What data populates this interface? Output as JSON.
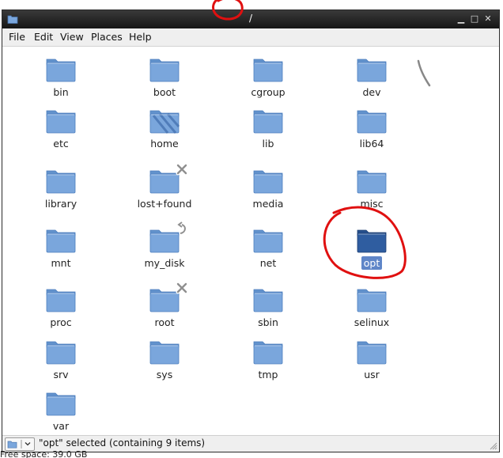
{
  "window": {
    "title": "/",
    "menu": [
      "File",
      "Edit",
      "View",
      "Places",
      "Help"
    ],
    "controls": [
      "minimize",
      "maximize",
      "close"
    ]
  },
  "items": [
    {
      "name": "bin"
    },
    {
      "name": "boot"
    },
    {
      "name": "cgroup"
    },
    {
      "name": "dev"
    },
    {
      "name": "etc"
    },
    {
      "name": "home",
      "special": "home"
    },
    {
      "name": "lib"
    },
    {
      "name": "lib64"
    },
    {
      "name": "library"
    },
    {
      "name": "lost+found",
      "emblem": "x-icon"
    },
    {
      "name": "media"
    },
    {
      "name": "misc"
    },
    {
      "name": "mnt"
    },
    {
      "name": "my_disk",
      "emblem": "symlink-arrow-icon"
    },
    {
      "name": "net"
    },
    {
      "name": "opt",
      "selected": true
    },
    {
      "name": "proc"
    },
    {
      "name": "root",
      "emblem": "x-icon"
    },
    {
      "name": "sbin"
    },
    {
      "name": "selinux"
    },
    {
      "name": "srv"
    },
    {
      "name": "sys"
    },
    {
      "name": "tmp"
    },
    {
      "name": "usr"
    },
    {
      "name": "var"
    }
  ],
  "status": {
    "text": "\"opt\" selected (containing 9 items)"
  },
  "free_space": "Free space: 39.0 GB",
  "colors": {
    "titlebar": "#1e1e1e",
    "folder": "#7aa6dc",
    "folder_selected": "#2f5da0",
    "selection": "#5f86c8",
    "annotation": "#e01010"
  }
}
